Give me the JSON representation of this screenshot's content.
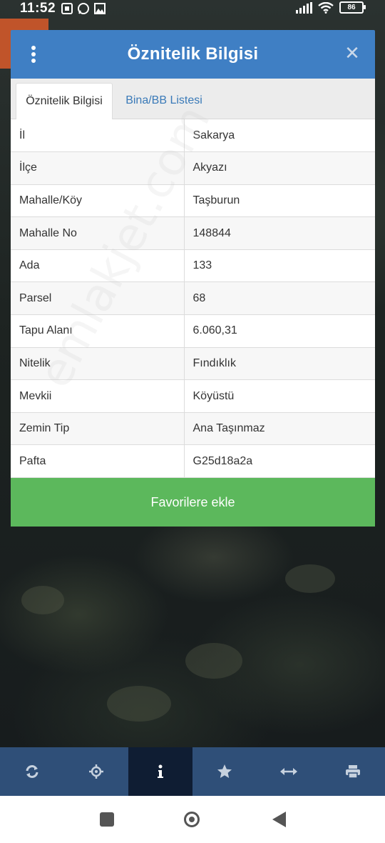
{
  "status_bar": {
    "time": "11:52",
    "notification_icons": [
      "sim-icon",
      "whatsapp-icon",
      "gallery-icon"
    ],
    "battery": "86"
  },
  "dialog": {
    "title": "Öznitelik Bilgisi",
    "tabs": [
      {
        "label": "Öznitelik Bilgisi",
        "active": true
      },
      {
        "label": "Bina/BB Listesi",
        "active": false
      }
    ],
    "rows": [
      {
        "key": "İl",
        "value": "Sakarya"
      },
      {
        "key": "İlçe",
        "value": "Akyazı"
      },
      {
        "key": "Mahalle/Köy",
        "value": "Taşburun"
      },
      {
        "key": "Mahalle No",
        "value": "148844"
      },
      {
        "key": "Ada",
        "value": "133"
      },
      {
        "key": "Parsel",
        "value": "68"
      },
      {
        "key": "Tapu Alanı",
        "value": "6.060,31"
      },
      {
        "key": "Nitelik",
        "value": "Fındıklık"
      },
      {
        "key": "Mevkii",
        "value": "Köyüstü"
      },
      {
        "key": "Zemin Tip",
        "value": "Ana Taşınmaz"
      },
      {
        "key": "Pafta",
        "value": "G25d18a2a"
      }
    ],
    "favorite_button": "Favorilere ekle"
  },
  "watermark": "emlakjet.com",
  "toolbar": {
    "items": [
      "refresh-icon",
      "locate-icon",
      "info-icon",
      "star-icon",
      "measure-icon",
      "print-icon"
    ],
    "active_index": 2
  },
  "colors": {
    "header": "#3f7fc4",
    "favorite": "#5cb85c",
    "toolbar": "#2f4f78",
    "toolbar_active": "#0f1d33"
  }
}
